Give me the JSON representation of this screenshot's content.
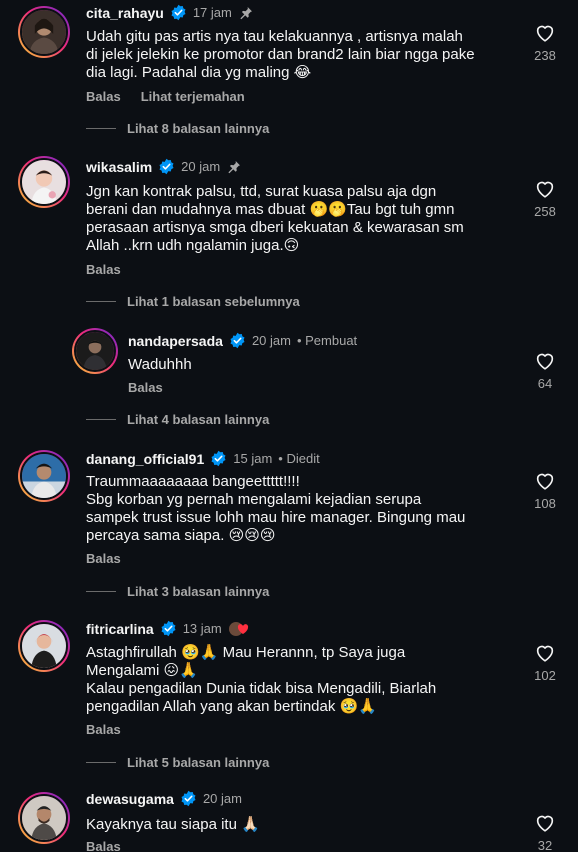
{
  "ui": {
    "reply_label": "Balas",
    "translate_label": "Lihat terjemahan"
  },
  "colors": {
    "background": "#0c0f14",
    "text": "#f5f5f5",
    "muted": "#a8a8a8",
    "verified": "#0095f6"
  },
  "comments": [
    {
      "username": "cita_rahayu",
      "verified": true,
      "time": "17 jam",
      "pinned": true,
      "text": "Udah gitu pas artis nya tau kelakuannya , artisnya malah\ndi jelek jelekin ke promotor dan brand2 lain biar ngga pake\ndia lagi. Padahal dia yg maling 😂",
      "likes": "238",
      "show_translate": true
    },
    {
      "username": "wikasalim",
      "verified": true,
      "time": "20 jam",
      "pinned": true,
      "text": "Jgn kan kontrak palsu, ttd, surat kuasa palsu aja dgn\nberani dan mudahnya mas dbuat 🫢🫢Tau bgt tuh gmn\nperasaan artisnya smga dberi kekuatan & kewarasan sm\nAllah ..krn udh ngalamin juga.🙃",
      "likes": "258"
    },
    {
      "username": "nandapersada",
      "verified": true,
      "time": "20 jam",
      "meta": "• Pembuat",
      "text": "Waduhhh",
      "likes": "64"
    },
    {
      "username": "danang_official91",
      "verified": true,
      "time": "15 jam",
      "meta": "• Diedit",
      "text": "Traummaaaaaaaa bangeettttt!!!!\nSbg korban yg pernah mengalami kejadian serupa\nsampek trust issue lohh mau hire manager. Bingung mau\npercaya sama siapa. 😢😢😢",
      "likes": "108"
    },
    {
      "username": "fitricarlina",
      "verified": true,
      "time": "13 jam",
      "text": "Astaghfirullah 🥹🙏 Mau Herannn, tp Saya juga\nMengalami 😖🙏\nKalau pengadilan Dunia tidak bisa Mengadili, Biarlah\npengadilan Allah yang akan bertindak 🥹🙏",
      "likes": "102"
    },
    {
      "username": "dewasugama",
      "verified": true,
      "time": "20 jam",
      "text": "Kayaknya tau siapa itu 🙏🏻",
      "likes": "32"
    }
  ],
  "reply_threads": [
    "Lihat 8 balasan lainnya",
    "Lihat 1 balasan sebelumnya",
    "Lihat 4 balasan lainnya",
    "Lihat 3 balasan lainnya",
    "Lihat 5 balasan lainnya"
  ]
}
